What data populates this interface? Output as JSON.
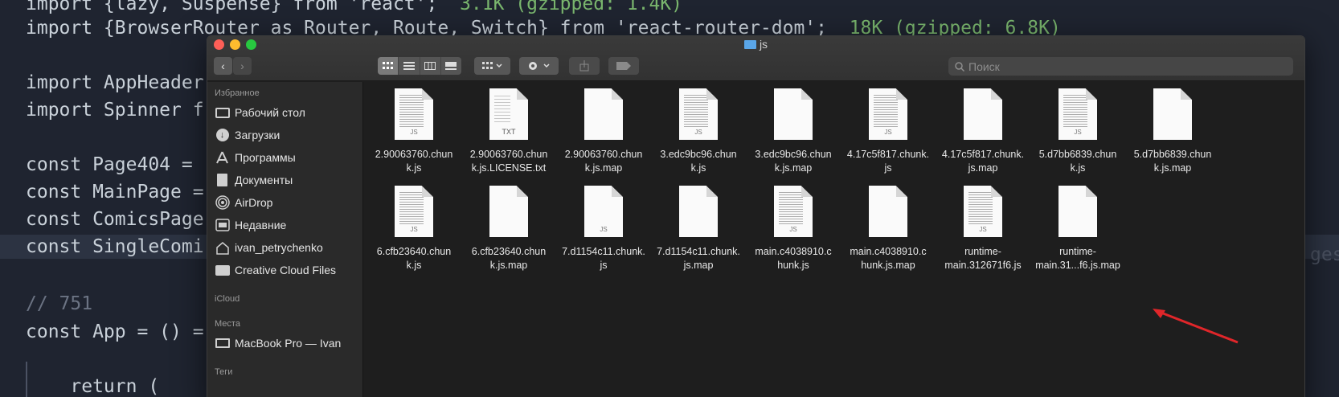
{
  "editor": {
    "lines": [
      {
        "id": "l1",
        "code": "import {lazy, Suspense} from 'react';",
        "hint": "  3.1K (gzipped: 1.4K)"
      },
      {
        "id": "l2",
        "code": "import {BrowserRouter as Router, Route, Switch} from 'react-router-dom';",
        "hint": "  18K (gzipped: 6.8K)"
      },
      {
        "id": "l3",
        "code": "import AppHeader"
      },
      {
        "id": "l4",
        "code": "import Spinner f"
      },
      {
        "id": "l5",
        "code": "const Page404 ="
      },
      {
        "id": "l6",
        "code": "const MainPage ="
      },
      {
        "id": "l7",
        "code": "const ComicsPage"
      },
      {
        "id": "l8",
        "code": "const SingleComi"
      },
      {
        "id": "l9",
        "code": "// 751"
      },
      {
        "id": "l10",
        "code": "const App = () ="
      },
      {
        "id": "l11",
        "code": "    return ("
      }
    ],
    "right_fragment": "ges"
  },
  "finder": {
    "title": "js",
    "search_placeholder": "Поиск",
    "nav_back": "‹",
    "nav_forward": "›",
    "sidebar": {
      "favorites_heading": "Избранное",
      "items": [
        {
          "label": "Рабочий стол",
          "icon": "desktop-icon"
        },
        {
          "label": "Загрузки",
          "icon": "downloads-icon"
        },
        {
          "label": "Программы",
          "icon": "applications-icon"
        },
        {
          "label": "Документы",
          "icon": "documents-icon"
        },
        {
          "label": "AirDrop",
          "icon": "airdrop-icon"
        },
        {
          "label": "Недавние",
          "icon": "recents-icon"
        },
        {
          "label": "ivan_petrychenko",
          "icon": "home-icon"
        },
        {
          "label": "Creative Cloud Files",
          "icon": "folder-icon"
        }
      ],
      "icloud_heading": "iCloud",
      "locations_heading": "Места",
      "locations": [
        {
          "label": "MacBook Pro — Ivan",
          "icon": "laptop-icon"
        }
      ],
      "tags_heading": "Теги"
    },
    "files": [
      {
        "name": "2.90063760.chunk.js",
        "line1": "2.90063760.chun",
        "line2": "k.js",
        "kind": "JS",
        "text_preview": true
      },
      {
        "name": "2.90063760.chunk.js.LICENSE.txt",
        "line1": "2.90063760.chun",
        "line2": "k.js.LICENSE.txt",
        "kind": "TXT",
        "text_preview": true
      },
      {
        "name": "2.90063760.chunk.js.map",
        "line1": "2.90063760.chun",
        "line2": "k.js.map",
        "kind": "",
        "text_preview": false
      },
      {
        "name": "3.edc9bc96.chunk.js",
        "line1": "3.edc9bc96.chun",
        "line2": "k.js",
        "kind": "JS",
        "text_preview": true
      },
      {
        "name": "3.edc9bc96.chunk.js.map",
        "line1": "3.edc9bc96.chun",
        "line2": "k.js.map",
        "kind": "",
        "text_preview": false
      },
      {
        "name": "4.17c5f817.chunk.js",
        "line1": "4.17c5f817.chunk.",
        "line2": "js",
        "kind": "JS",
        "text_preview": true
      },
      {
        "name": "4.17c5f817.chunk.js.map",
        "line1": "4.17c5f817.chunk.",
        "line2": "js.map",
        "kind": "",
        "text_preview": false
      },
      {
        "name": "5.d7bb6839.chunk.js",
        "line1": "5.d7bb6839.chun",
        "line2": "k.js",
        "kind": "JS",
        "text_preview": true
      },
      {
        "name": "5.d7bb6839.chunk.js.map",
        "line1": "5.d7bb6839.chun",
        "line2": "k.js.map",
        "kind": "",
        "text_preview": false
      },
      {
        "name": "6.cfb23640.chunk.js",
        "line1": "6.cfb23640.chun",
        "line2": "k.js",
        "kind": "JS",
        "text_preview": true
      },
      {
        "name": "6.cfb23640.chunk.js.map",
        "line1": "6.cfb23640.chun",
        "line2": "k.js.map",
        "kind": "",
        "text_preview": false
      },
      {
        "name": "7.d1154c11.chunk.js",
        "line1": "7.d1154c11.chunk.",
        "line2": "js",
        "kind": "JS",
        "text_preview": false
      },
      {
        "name": "7.d1154c11.chunk.js.map",
        "line1": "7.d1154c11.chunk.",
        "line2": "js.map",
        "kind": "",
        "text_preview": false
      },
      {
        "name": "main.c4038910.chunk.js",
        "line1": "main.c4038910.c",
        "line2": "hunk.js",
        "kind": "JS",
        "text_preview": true
      },
      {
        "name": "main.c4038910.chunk.js.map",
        "line1": "main.c4038910.c",
        "line2": "hunk.js.map",
        "kind": "",
        "text_preview": false
      },
      {
        "name": "runtime-main.312671f6.js",
        "line1": "runtime-",
        "line2": "main.312671f6.js",
        "kind": "JS",
        "text_preview": true
      },
      {
        "name": "runtime-main.31...f6.js.map",
        "line1": "runtime-",
        "line2": "main.31...f6.js.map",
        "kind": "",
        "text_preview": false
      }
    ]
  },
  "annotation": {
    "color": "#e0262a",
    "icon": "arrow-icon"
  }
}
